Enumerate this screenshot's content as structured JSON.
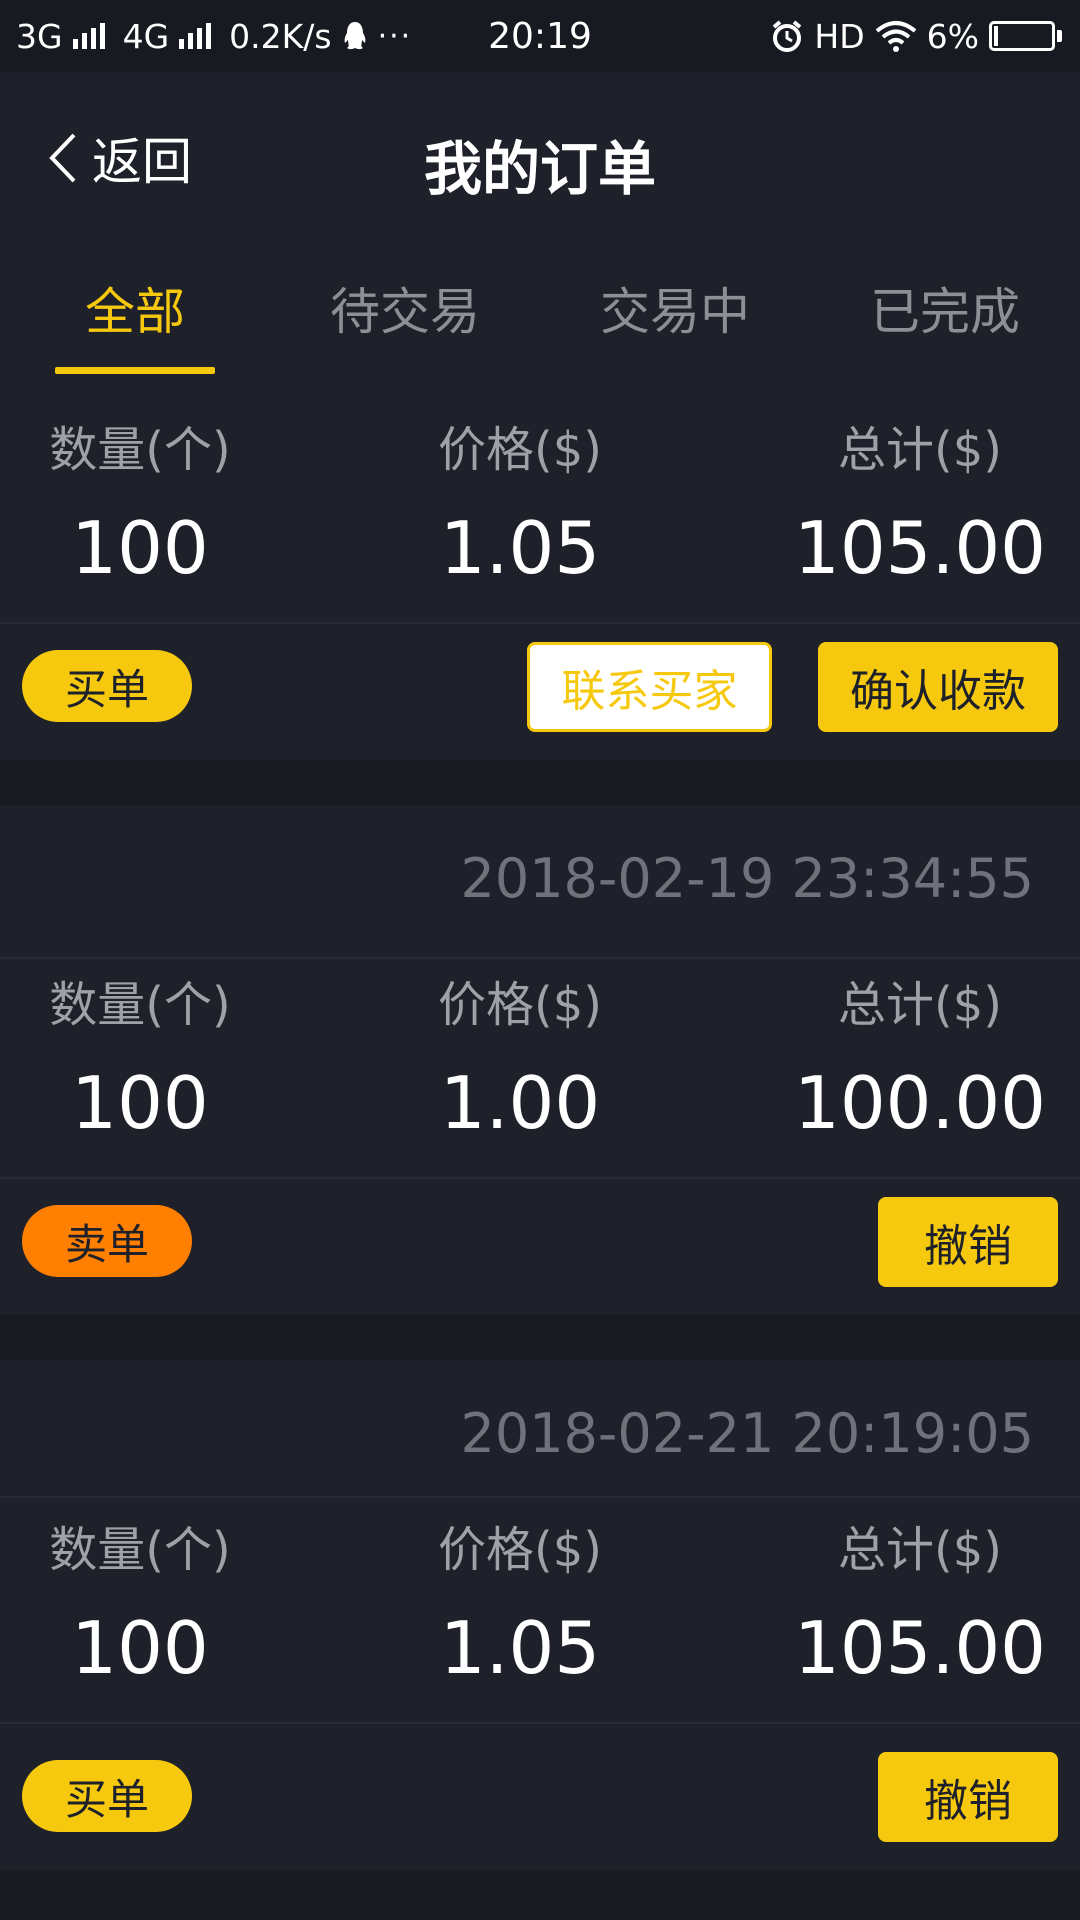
{
  "status_bar": {
    "net1": "3G",
    "net2": "4G",
    "speed": "0.2K/s",
    "more": "···",
    "time": "20:19",
    "hd": "HD",
    "battery": "6%"
  },
  "header": {
    "back_label": "返回",
    "title": "我的订单"
  },
  "tabs": [
    {
      "label": "全部",
      "active": true
    },
    {
      "label": "待交易",
      "active": false
    },
    {
      "label": "交易中",
      "active": false
    },
    {
      "label": "已完成",
      "active": false
    }
  ],
  "columns": {
    "qty": "数量(个)",
    "price": "价格($)",
    "total": "总计($)"
  },
  "orders": [
    {
      "timestamp": "",
      "qty": "100",
      "price": "1.05",
      "total": "105.00",
      "type": "买单",
      "contact_label": "联系买家",
      "action_label": "确认收款"
    },
    {
      "timestamp": "2018-02-19 23:34:55",
      "qty": "100",
      "price": "1.00",
      "total": "100.00",
      "type": "卖单",
      "action_label": "撤销"
    },
    {
      "timestamp": "2018-02-21 20:19:05",
      "qty": "100",
      "price": "1.05",
      "total": "105.00",
      "type": "买单",
      "action_label": "撤销"
    }
  ],
  "colors": {
    "accent": "#f6c90e",
    "sell": "#ff7f00",
    "card_bg": "#1e212a",
    "page_bg": "#181b22"
  }
}
